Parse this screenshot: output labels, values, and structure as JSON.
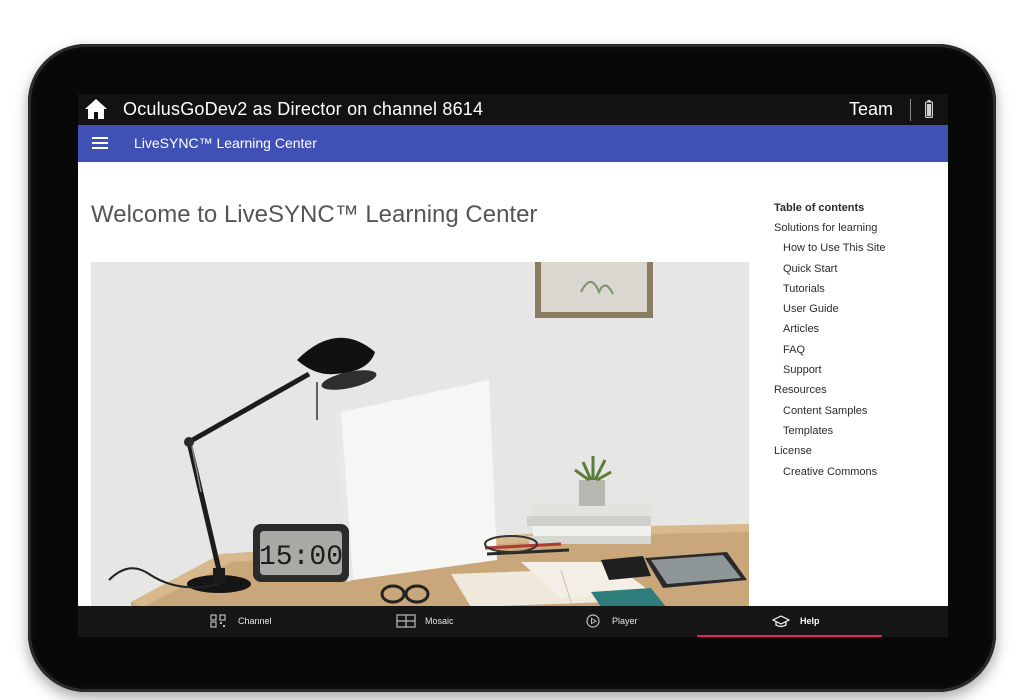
{
  "topbar": {
    "title": "OculusGoDev2 as Director on channel 8614",
    "team_label": "Team",
    "icons": [
      "home-icon",
      "battery-icon"
    ]
  },
  "header": {
    "site_title": "LiveSYNC™ Learning Center",
    "menu_icon": "menu-icon",
    "color": "#3f51b5"
  },
  "main": {
    "page_title": "Welcome to LiveSYNC™ Learning Center",
    "hero_image": {
      "clock_text": "15:00"
    }
  },
  "toc": {
    "heading": "Table of contents",
    "items": [
      {
        "label": "Solutions for learning",
        "level": 1
      },
      {
        "label": "How to Use This Site",
        "level": 2
      },
      {
        "label": "Quick Start",
        "level": 2
      },
      {
        "label": "Tutorials",
        "level": 2
      },
      {
        "label": "User Guide",
        "level": 2
      },
      {
        "label": "Articles",
        "level": 2
      },
      {
        "label": "FAQ",
        "level": 2
      },
      {
        "label": "Support",
        "level": 2
      },
      {
        "label": "Resources",
        "level": 1
      },
      {
        "label": "Content Samples",
        "level": 2
      },
      {
        "label": "Templates",
        "level": 2
      },
      {
        "label": "License",
        "level": 1
      },
      {
        "label": "Creative Commons",
        "level": 2
      }
    ]
  },
  "bottom_nav": {
    "items": [
      {
        "label": "Channel",
        "icon": "channel-icon"
      },
      {
        "label": "Mosaic",
        "icon": "mosaic-icon"
      },
      {
        "label": "Player",
        "icon": "player-icon"
      },
      {
        "label": "Help",
        "icon": "help-icon"
      }
    ],
    "active": "Help",
    "active_color": "#e91e63"
  }
}
